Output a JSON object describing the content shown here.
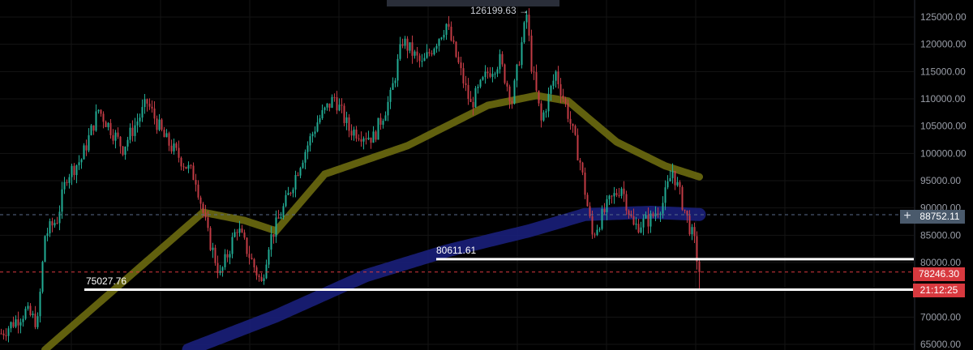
{
  "chart_data": {
    "type": "candlestick",
    "title": "",
    "ylim": [
      65000,
      126500
    ],
    "y_ticks": [
      "125000.00",
      "120000.00",
      "115000.00",
      "110000.00",
      "105000.00",
      "100000.00",
      "95000.00",
      "90000.00",
      "85000.00",
      "80000.00",
      "70000.00",
      "65000.00"
    ],
    "y_tick_values": [
      125000,
      120000,
      115000,
      110000,
      105000,
      100000,
      95000,
      90000,
      85000,
      80000,
      70000,
      65000
    ],
    "price_path": [
      [
        0,
        67000
      ],
      [
        10,
        71000
      ],
      [
        15,
        69000
      ],
      [
        18,
        85000
      ],
      [
        23,
        88000
      ],
      [
        27,
        96000
      ],
      [
        33,
        99000
      ],
      [
        40,
        108000
      ],
      [
        50,
        101000
      ],
      [
        60,
        109300
      ],
      [
        67,
        102900
      ],
      [
        80,
        95400
      ],
      [
        85,
        85000
      ],
      [
        90,
        77600
      ],
      [
        97,
        86500
      ],
      [
        107,
        76100
      ],
      [
        110,
        83600
      ],
      [
        117,
        91000
      ],
      [
        123,
        98400
      ],
      [
        130,
        105800
      ],
      [
        137,
        110300
      ],
      [
        143,
        104400
      ],
      [
        153,
        102900
      ],
      [
        160,
        110300
      ],
      [
        165,
        120700
      ],
      [
        173,
        116200
      ],
      [
        183,
        123700
      ],
      [
        193,
        108800
      ],
      [
        200,
        114800
      ],
      [
        205,
        117000
      ],
      [
        210,
        109600
      ],
      [
        216,
        125400
      ],
      [
        218,
        116200
      ],
      [
        222,
        105800
      ],
      [
        228,
        114800
      ],
      [
        233,
        107300
      ],
      [
        238,
        98400
      ],
      [
        243,
        85000
      ],
      [
        250,
        91000
      ],
      [
        255,
        94000
      ],
      [
        260,
        86500
      ],
      [
        267,
        88000
      ],
      [
        272,
        91000
      ],
      [
        276,
        96900
      ],
      [
        282,
        88000
      ],
      [
        285,
        83600
      ],
      [
        287,
        78246
      ]
    ],
    "ma_slow": {
      "name": "MA (olive)",
      "color": "#6b6a10",
      "points": [
        [
          18,
          64000
        ],
        [
          83,
          89200
        ],
        [
          100,
          87700
        ],
        [
          113,
          85800
        ],
        [
          133,
          96200
        ],
        [
          167,
          101400
        ],
        [
          200,
          108800
        ],
        [
          220,
          110600
        ],
        [
          233,
          109600
        ],
        [
          253,
          102100
        ],
        [
          273,
          97700
        ],
        [
          287,
          95700
        ]
      ]
    },
    "ma_fast": {
      "name": "MA (blue)",
      "color": "#1a1f7a",
      "points": [
        [
          77,
          64000
        ],
        [
          113,
          70200
        ],
        [
          150,
          77600
        ],
        [
          183,
          82100
        ],
        [
          217,
          85800
        ],
        [
          240,
          88800
        ],
        [
          267,
          89200
        ],
        [
          287,
          88800
        ]
      ]
    },
    "high_label": "126199.63 →",
    "high_value": 126199.63,
    "hlines": [
      {
        "label": "80611.61",
        "value": 80611.61
      },
      {
        "label": "75027.76",
        "value": 75027.76
      }
    ],
    "crosshair_price": "88752.11",
    "crosshair_value": 88752.11,
    "last_price": "78246.30",
    "last_value": 78246.3,
    "countdown": "21:12:25",
    "colors": {
      "up": "#22ab94",
      "down": "#c23b45",
      "last": "#d8393f",
      "cross": "#4a5a6c"
    }
  }
}
